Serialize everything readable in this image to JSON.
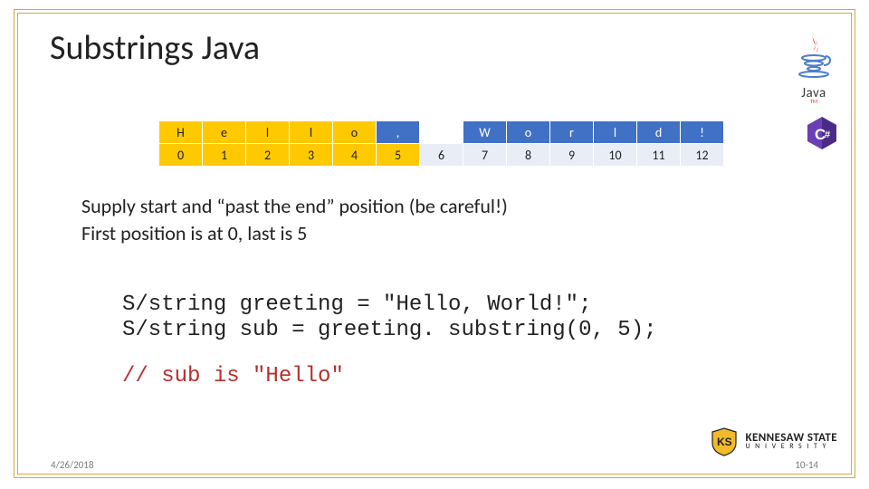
{
  "title": "Substrings Java",
  "chart_data": {
    "type": "table",
    "rows": [
      [
        "H",
        "e",
        "l",
        "l",
        "o",
        ",",
        "",
        "W",
        "o",
        "r",
        "l",
        "d",
        "!"
      ],
      [
        "0",
        "1",
        "2",
        "3",
        "4",
        "5",
        "6",
        "7",
        "8",
        "9",
        "10",
        "11",
        "12"
      ]
    ],
    "highlight_cols_row1": [
      0,
      1,
      2,
      3,
      4
    ],
    "highlight_cols_row2": [
      0,
      1,
      2,
      3,
      4,
      5
    ]
  },
  "body": {
    "line1": "Supply start and “past the end” position (be careful!)",
    "line2": "First position is at 0, last is 5"
  },
  "code": {
    "line1": "S/string greeting = \"Hello, World!\";",
    "line2": "S/string sub = greeting. substring(0, 5);",
    "comment": "// sub is \"Hello\""
  },
  "logos": {
    "java_text": "Java",
    "ksu_name": "KENNESAW STATE",
    "ksu_sub": "UNIVERSITY"
  },
  "footer": {
    "date": "4/26/2018",
    "page": "10-14"
  }
}
